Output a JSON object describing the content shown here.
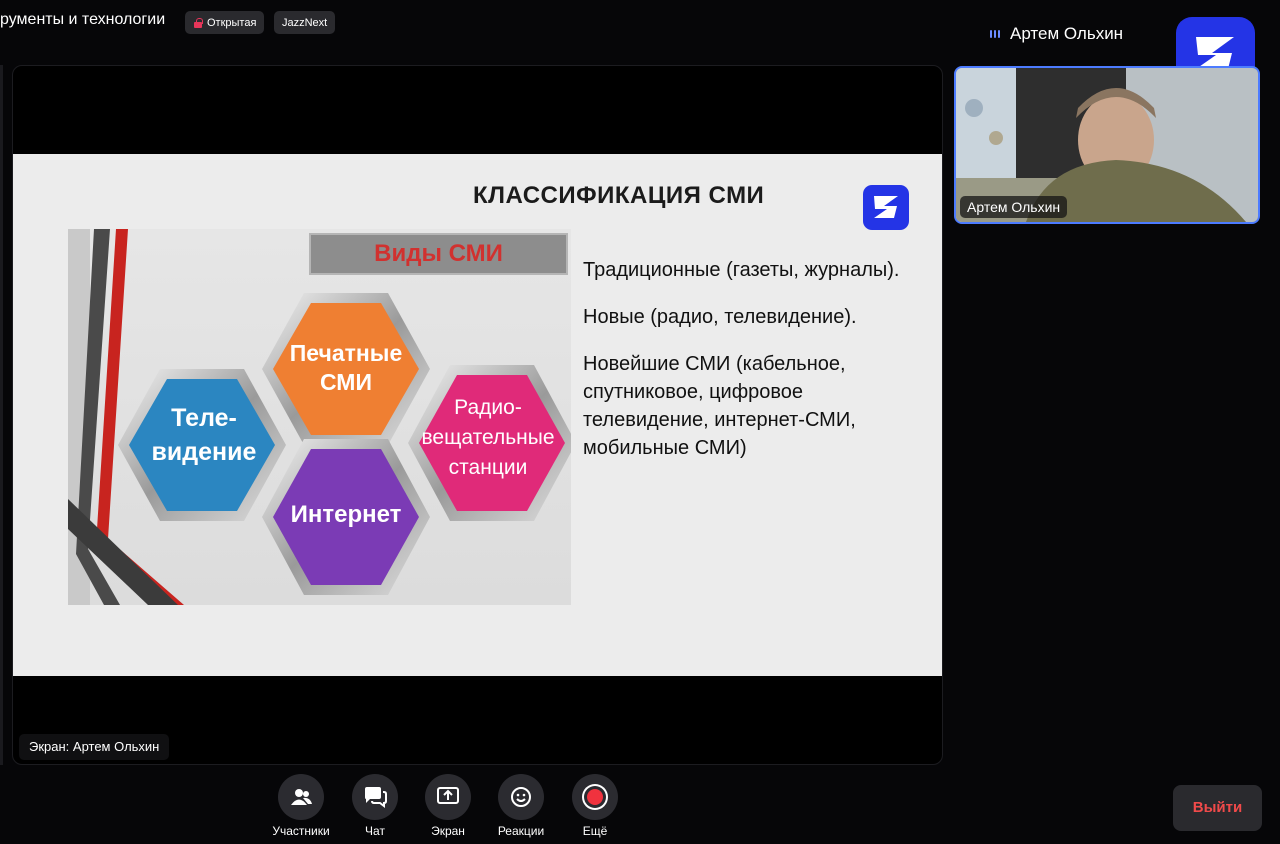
{
  "header": {
    "meeting_title": "рументы и технологии",
    "badge_open": "Открытая",
    "badge_jazz": "JazzNext",
    "speaker_name": "Артем Ольхин"
  },
  "slide": {
    "title": "КЛАССИФИКАЦИЯ СМИ",
    "banner": "Виды СМИ",
    "hex_print": "Печатные СМИ",
    "hex_tv": "Теле-видение",
    "hex_radio": "Радио-вещательные станции",
    "hex_internet": "Интернет",
    "item1": "Традиционные (газеты, журналы).",
    "item2": "Новые (радио, телевидение).",
    "item3": "Новейшие СМИ (кабельное, спутниковое, цифровое телевидение, интернет-СМИ, мобильные СМИ)"
  },
  "screen_share_label": "Экран: Артем Ольхин",
  "webcam_label": "Артем Ольхин",
  "controls": {
    "participants": "Участники",
    "chat": "Чат",
    "screen": "Экран",
    "reactions": "Реакции",
    "more": "Ещё"
  },
  "exit_label": "Выйти",
  "colors": {
    "accent_blue": "#2434e6",
    "hex_orange": "#ef7f32",
    "hex_blue": "#2b86c1",
    "hex_pink": "#e02a79",
    "hex_purple": "#7b3bb5",
    "banner_red": "#d1312f",
    "exit_red": "#f04a4a"
  }
}
